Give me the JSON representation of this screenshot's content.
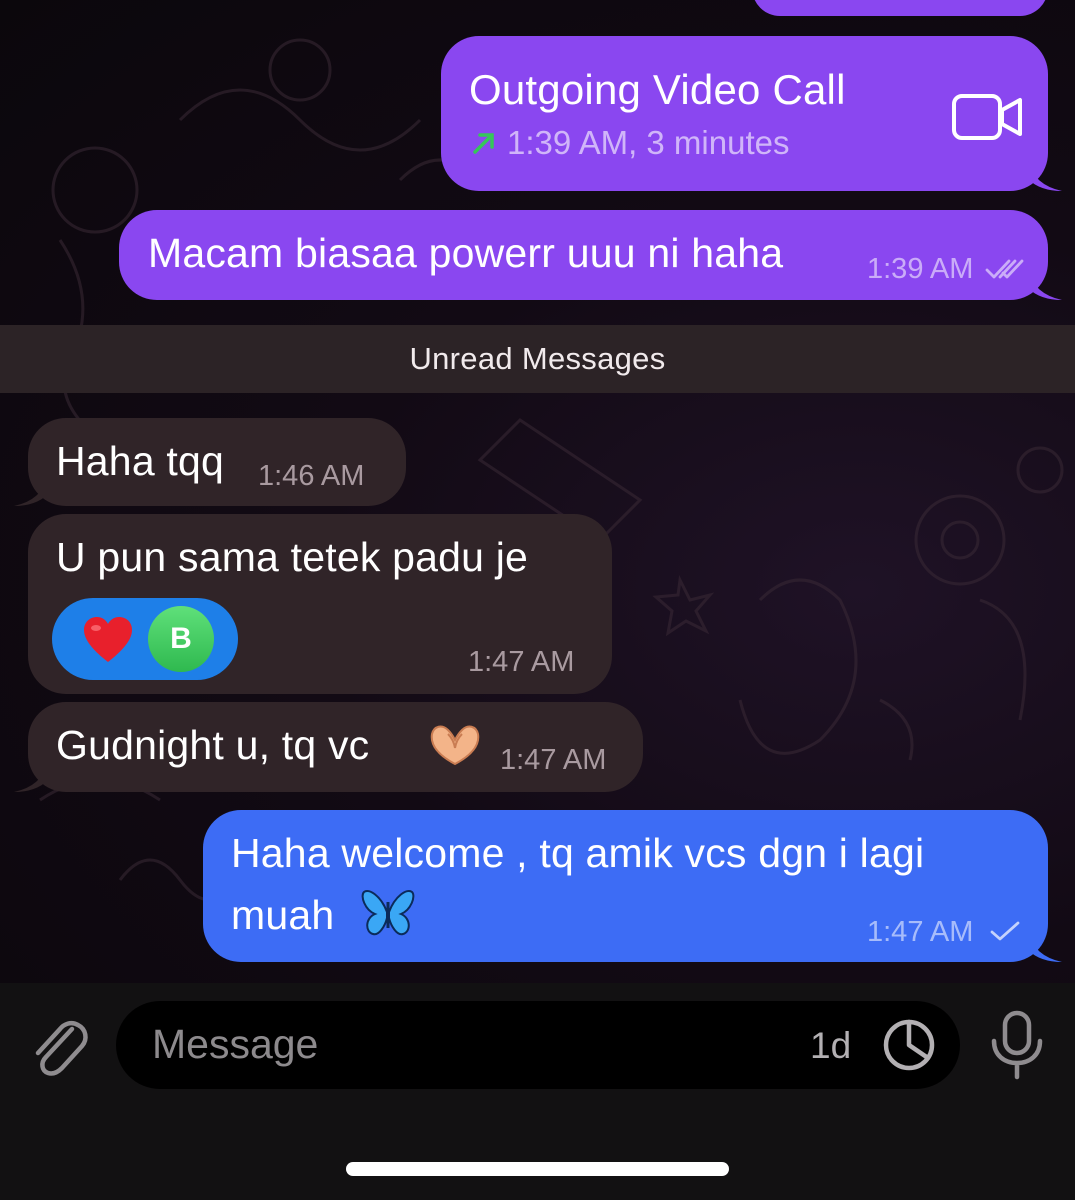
{
  "messages": [
    {
      "id": "call",
      "direction": "outgoing",
      "title": "Outgoing Video Call",
      "detail": "1:39 AM, 3 minutes"
    },
    {
      "id": "m1",
      "direction": "outgoing",
      "text": "Macam biasaa powerr uuu ni haha",
      "time": "1:39 AM",
      "status": "read"
    },
    {
      "id": "m2",
      "direction": "incoming",
      "text": "Haha tqq",
      "time": "1:46 AM"
    },
    {
      "id": "m3",
      "direction": "incoming",
      "text": "U pun sama tetek padu je",
      "time": "1:47 AM",
      "reaction": {
        "emoji": "heart",
        "avatar_letter": "B"
      }
    },
    {
      "id": "m4",
      "direction": "incoming",
      "text": "Gudnight u, tq vc",
      "emoji": "heart-hands",
      "time": "1:47 AM"
    },
    {
      "id": "m5",
      "direction": "outgoing",
      "text_line1": "Haha welcome , tq amik vcs dgn i lagi",
      "text_line2": "muah",
      "emoji": "butterfly",
      "time": "1:47 AM",
      "status": "sent"
    }
  ],
  "unread_divider": "Unread Messages",
  "composer": {
    "placeholder": "Message",
    "timer_label": "1d",
    "icons": [
      "paperclip-icon",
      "timer-icon",
      "microphone-icon"
    ]
  },
  "colors": {
    "outgoing": "#8a47f0",
    "outgoing_highlight": "#3d6cf5",
    "incoming": "#302428",
    "call_arrow": "#35c759",
    "reaction_pill": "#1e7fe8"
  }
}
